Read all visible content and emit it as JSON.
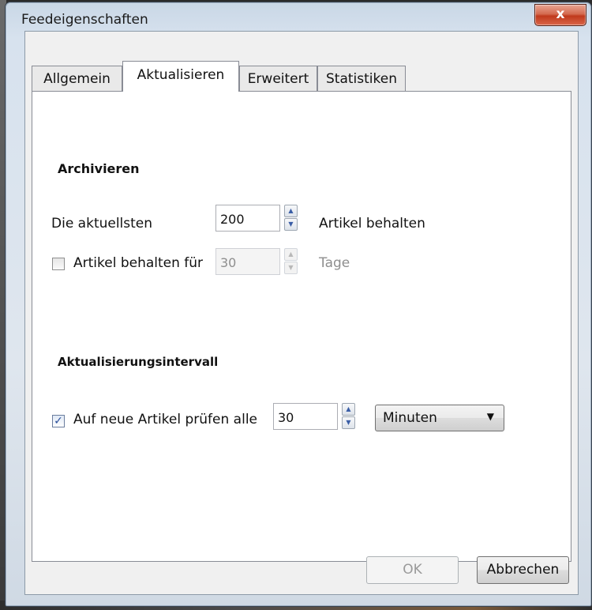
{
  "window": {
    "title": "Feedeigenschaften",
    "close_glyph": "x"
  },
  "tabs": [
    {
      "label": "Allgemein",
      "active": false
    },
    {
      "label": "Aktualisieren",
      "active": true
    },
    {
      "label": "Erweitert",
      "active": false
    },
    {
      "label": "Statistiken",
      "active": false
    }
  ],
  "archive": {
    "section_title": "Archivieren",
    "keep_latest_label": "Die aktuellsten",
    "keep_latest_value": "200",
    "keep_latest_suffix": "Artikel behalten",
    "keep_for_checked": false,
    "keep_for_label": "Artikel behalten für",
    "keep_for_value": "30",
    "keep_for_suffix": "Tage"
  },
  "update": {
    "section_title": "Aktualisierungsintervall",
    "check_checked": true,
    "check_label": "Auf neue Artikel prüfen alle",
    "interval_value": "30",
    "unit_selected": "Minuten"
  },
  "buttons": {
    "ok_label": "OK",
    "cancel_label": "Abbrechen"
  },
  "icons": {
    "spin_up": "▲",
    "spin_down": "▼",
    "combo_arrow": "▼",
    "check_mark": "✓"
  }
}
